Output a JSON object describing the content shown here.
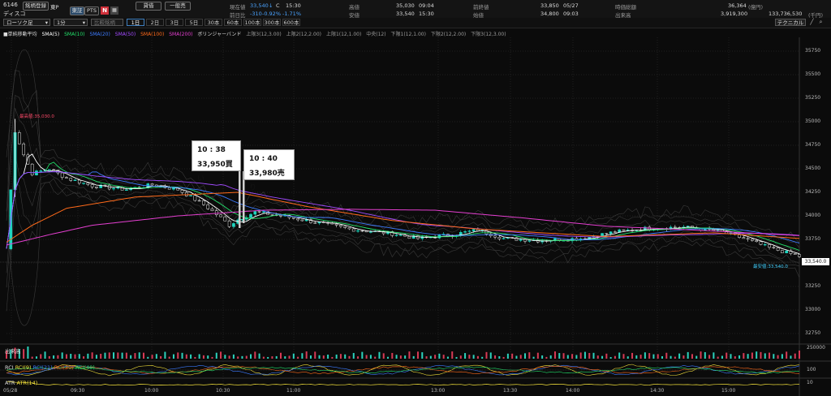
{
  "header": {
    "code": "6146",
    "name": "ディスコ",
    "btn_register": "銘柄登録",
    "market": "東P",
    "btn_tosho": "東証",
    "btn_pts": "PTS",
    "nikkei": "N",
    "btn_credit": "貸借",
    "btn_general": "一般売",
    "quote": {
      "genzai_label": "現在値",
      "genzai_value": "33,540",
      "genzai_arrow": "↓",
      "genzai_c": "C",
      "genzai_time": "15:30",
      "zenjitsu_label": "前日比",
      "zenjitsu_value": "-310",
      "zenjitsu_pct": "-0.92%",
      "zenjitsu_pct2": "-1.71%",
      "takane_label": "高値",
      "takane_value": "35,030",
      "takane_time": "09:04",
      "yasune_label": "安値",
      "yasune_value": "33,540",
      "yasune_time": "15:30",
      "zenowari_label": "前終値",
      "zenowari_value": "33,850",
      "zenowari_date": "05/27",
      "hajime_label": "始値",
      "hajime_value": "34,800",
      "hajime_time": "09:03",
      "jika_label": "時価総額",
      "jika_value": "36,364",
      "jika_unit": "(億円)",
      "dekidaka_label": "出来高",
      "dekidaka_value": "3,919,300",
      "baibai_value": "133,736,530",
      "baibai_unit": "(千円)"
    }
  },
  "toolbar": {
    "chart_type": "ローソク足",
    "interval": "1分",
    "compare": "比較銘柄",
    "timeframes": [
      "1日",
      "2日",
      "3日",
      "5日",
      "30本",
      "60本",
      "100本",
      "300本",
      "600本"
    ],
    "active_timeframe": "1日",
    "technical": "テクニカル"
  },
  "legend": {
    "title": "■単純移動平均",
    "sma5": "SMA(5)",
    "sma10": "SMA(10)",
    "sma20": "SMA(20)",
    "sma50": "SMA(50)",
    "sma100": "SMA(100)",
    "sma200": "SMA(200)",
    "bb": "ボリンジャーバンド",
    "b1": "上限3(12,3.00)",
    "b2": "上限2(12,2.00)",
    "b3": "上限1(12,1.00)",
    "b4": "中央(12)",
    "b5": "下限1(12,1.00)",
    "b6": "下限2(12,2.00)",
    "b7": "下限3(12,3.00)"
  },
  "annotations": {
    "high": "最高値:35,030.0",
    "low": "最安値:33,540.0",
    "last_price": "33,540.0"
  },
  "callouts": [
    {
      "time": "10 : 38",
      "text": "33,950買い"
    },
    {
      "time": "10 : 40",
      "text": "33,980売り"
    }
  ],
  "panels": {
    "volume": "出来高",
    "rci": "RCI",
    "rci9": "RCI(9)",
    "rci21": "RCI(21)",
    "rci30": "RCI(30)",
    "rci40": "RCI(40)",
    "atr": "ATR",
    "atr14": "ATR(14)",
    "vol_tick": "250000",
    "rci_tick": "100",
    "atr_tick": "10"
  },
  "colors": {
    "up": "#1fd6c0",
    "down": "#e8e8e8",
    "sma5": "#ffffff",
    "sma10": "#22e06a",
    "sma20": "#3d7bff",
    "sma50": "#a24bff",
    "sma100": "#ff6a1a",
    "sma200": "#e43fd0"
  },
  "chart_data": {
    "type": "candlestick",
    "ylim": [
      32700,
      35850
    ],
    "y_ticks": [
      "35750",
      "35500",
      "35250",
      "35000",
      "34750",
      "34500",
      "34250",
      "34000",
      "33750",
      "33500",
      "33250",
      "33000",
      "32750"
    ],
    "x_ticks": [
      "05/28",
      "09:30",
      "10:00",
      "10:30",
      "11:00",
      "13:00",
      "13:30",
      "14:00",
      "14:30",
      "15:00"
    ],
    "price_path": [
      [
        0,
        33650
      ],
      [
        2,
        34900
      ],
      [
        4,
        34650
      ],
      [
        6,
        34450
      ],
      [
        10,
        34500
      ],
      [
        14,
        34400
      ],
      [
        20,
        34320
      ],
      [
        28,
        34280
      ],
      [
        34,
        34330
      ],
      [
        40,
        34280
      ],
      [
        46,
        34120
      ],
      [
        50,
        33980
      ],
      [
        52,
        33900
      ],
      [
        54,
        33960
      ],
      [
        58,
        34040
      ],
      [
        64,
        34000
      ],
      [
        70,
        33950
      ],
      [
        80,
        33860
      ],
      [
        90,
        33810
      ],
      [
        96,
        33760
      ],
      [
        104,
        33800
      ],
      [
        110,
        33850
      ],
      [
        116,
        33760
      ],
      [
        124,
        33740
      ],
      [
        134,
        33760
      ],
      [
        142,
        33830
      ],
      [
        150,
        33870
      ],
      [
        158,
        33880
      ],
      [
        166,
        33840
      ],
      [
        172,
        33760
      ],
      [
        178,
        33660
      ],
      [
        182,
        33610
      ],
      [
        185,
        33570
      ]
    ],
    "sma200_path": [
      [
        0,
        33690
      ],
      [
        10,
        33800
      ],
      [
        20,
        33900
      ],
      [
        40,
        34000
      ],
      [
        60,
        34060
      ],
      [
        80,
        34070
      ],
      [
        100,
        34060
      ],
      [
        120,
        33980
      ],
      [
        140,
        33890
      ],
      [
        160,
        33850
      ],
      [
        185,
        33790
      ]
    ],
    "sma100_path": [
      [
        0,
        33720
      ],
      [
        6,
        33900
      ],
      [
        14,
        34080
      ],
      [
        30,
        34200
      ],
      [
        54,
        34250
      ],
      [
        70,
        34100
      ],
      [
        90,
        33950
      ],
      [
        110,
        33860
      ],
      [
        140,
        33780
      ],
      [
        165,
        33820
      ],
      [
        185,
        33760
      ]
    ]
  }
}
